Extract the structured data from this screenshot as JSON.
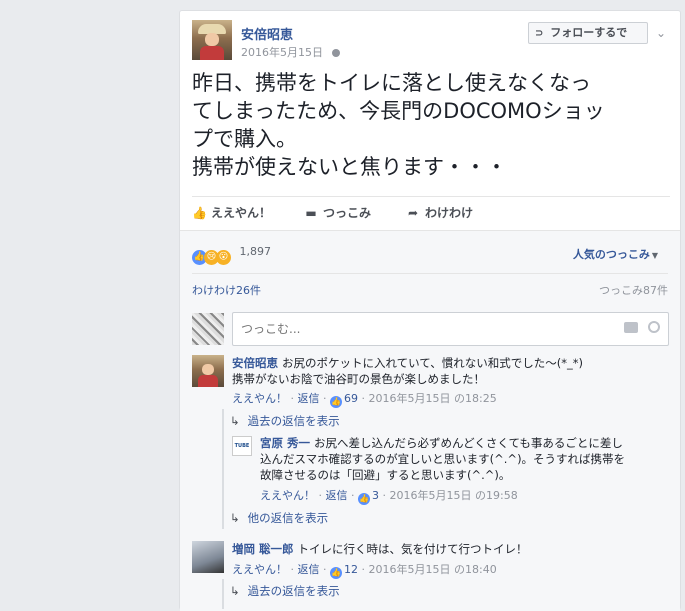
{
  "post": {
    "author": "安倍昭恵",
    "date": "2016年5月15日",
    "follow_label": "フォローするで",
    "text_lines": [
      "昨日、携帯をトイレに落とし使えなくなっ",
      "てしまったため、今長門のDOCOMOショッ",
      "プで購入。",
      "携帯が使えないと焦ります・・・"
    ],
    "actions": {
      "like": "ええやん！",
      "comment": "つっこみ",
      "share": "わけわけ"
    }
  },
  "feedback": {
    "reaction_count": "1,897",
    "sort_label": "人気のつっこみ",
    "shares": "わけわけ26件",
    "comments_count": "つっこみ87件",
    "comment_placeholder": "つっこむ..."
  },
  "comments": [
    {
      "name": "安倍昭恵",
      "text_line1": "お尻のポケットに入れていて、慣れない和式でした〜(*_*)",
      "text_line2": "携帯がないお陰で油谷町の景色が楽しめました！",
      "like": "ええやん！",
      "reply": "返信",
      "likes": "69",
      "time": "2016年5月15日 の18:25",
      "prev_replies": "過去の返信を表示",
      "reply_item": {
        "avatar_text": "TUBE",
        "name": "宮原 秀一",
        "line1": "お尻へ差し込んだら必ずめんどくさくても事あるごとに差し",
        "line2": "込んだスマホ確認するのが宜しいと思います(^.^)。そうすれば携帯を",
        "line3": "故障させるのは「回避」すると思います(^.^)。",
        "like": "ええやん！",
        "reply": "返信",
        "likes": "3",
        "time": "2016年5月15日 の19:58"
      },
      "other_replies": "他の返信を表示"
    },
    {
      "name": "増岡 聡一郎",
      "text_line1": "トイレに行く時は、気を付けて行つトイレ！",
      "like": "ええやん！",
      "reply": "返信",
      "likes": "12",
      "time": "2016年5月15日 の18:40",
      "prev_replies": "過去の返信を表示"
    }
  ]
}
